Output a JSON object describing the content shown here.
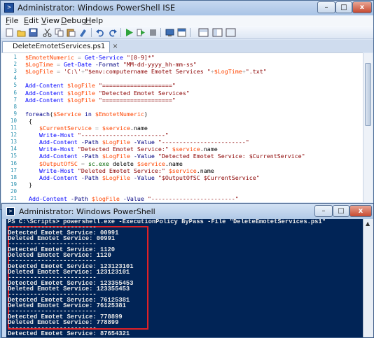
{
  "ise": {
    "title": "Administrator: Windows PowerShell ISE",
    "menu": [
      {
        "pre": "",
        "ul": "F",
        "post": "ile"
      },
      {
        "pre": "",
        "ul": "E",
        "post": "dit"
      },
      {
        "pre": "",
        "ul": "V",
        "post": "iew"
      },
      {
        "pre": "",
        "ul": "D",
        "post": "ebug"
      },
      {
        "pre": "",
        "ul": "H",
        "post": "elp"
      }
    ],
    "tab_label": "DeleteEmotetServices.ps1",
    "toolbar_icons": [
      "new-icon",
      "open-icon",
      "save-icon",
      "cut-icon",
      "copy-icon",
      "paste-icon",
      "clear-icon",
      "undo-icon",
      "redo-icon",
      "run-icon",
      "run-selection-icon",
      "stop-icon",
      "new-remote-tab-icon",
      "show-script-pane-top-icon",
      "show-script-pane-right-icon",
      "show-script-pane-maximized-icon"
    ]
  },
  "editor": {
    "line_numbers": [
      "1",
      "2",
      "3",
      "4",
      "5",
      "6",
      "7",
      "8",
      "9",
      "10",
      "11",
      "12",
      "13",
      "14",
      "15",
      "16",
      "17",
      "18",
      "19",
      "20",
      "21"
    ],
    "lines": [
      [
        {
          "c": "var",
          "t": "$EmotetNumeric"
        },
        {
          "c": "op",
          "t": " = "
        },
        {
          "c": "cmd",
          "t": "Get-Service"
        },
        {
          "c": "str",
          "t": " \"[0-9]*\""
        }
      ],
      [
        {
          "c": "var",
          "t": "$LogTime"
        },
        {
          "c": "op",
          "t": " = "
        },
        {
          "c": "cmd",
          "t": "Get-Date"
        },
        {
          "c": "prm",
          "t": " -Format"
        },
        {
          "c": "str",
          "t": " \"MM-dd-yyyy_hh-mm-ss\""
        }
      ],
      [
        {
          "c": "var",
          "t": "$LogFile"
        },
        {
          "c": "op",
          "t": " = "
        },
        {
          "c": "str",
          "t": "'C:\\'"
        },
        {
          "c": "op",
          "t": "+"
        },
        {
          "c": "str",
          "t": "\"$env:computername Emotet Services \""
        },
        {
          "c": "op",
          "t": "+"
        },
        {
          "c": "var",
          "t": "$LogTime"
        },
        {
          "c": "op",
          "t": "+"
        },
        {
          "c": "str",
          "t": "\".txt\""
        }
      ],
      [],
      [
        {
          "c": "cmd",
          "t": "Add-Content"
        },
        {
          "c": "var",
          "t": " $logFile"
        },
        {
          "c": "str",
          "t": " \"====================\""
        }
      ],
      [
        {
          "c": "cmd",
          "t": "Add-Content"
        },
        {
          "c": "var",
          "t": " $logFile"
        },
        {
          "c": "str",
          "t": " \"Detected Emotet Services\""
        }
      ],
      [
        {
          "c": "cmd",
          "t": "Add-Content"
        },
        {
          "c": "var",
          "t": " $logFile"
        },
        {
          "c": "str",
          "t": " \"====================\""
        }
      ],
      [],
      [
        {
          "c": "kw",
          "t": "foreach"
        },
        {
          "c": "txt",
          "t": "("
        },
        {
          "c": "var",
          "t": "$Service"
        },
        {
          "c": "kw",
          "t": " in "
        },
        {
          "c": "var",
          "t": "$EmotetNumeric"
        },
        {
          "c": "txt",
          "t": ")"
        }
      ],
      [
        {
          "c": "txt",
          "t": " {"
        }
      ],
      [
        {
          "c": "var",
          "t": "    $CurrentService"
        },
        {
          "c": "op",
          "t": " = "
        },
        {
          "c": "var",
          "t": "$service"
        },
        {
          "c": "txt",
          "t": ".name"
        }
      ],
      [
        {
          "c": "cmd",
          "t": "    Write-Host"
        },
        {
          "c": "str",
          "t": " \"------------------------\""
        }
      ],
      [
        {
          "c": "cmd",
          "t": "    Add-Content"
        },
        {
          "c": "prm",
          "t": " -Path"
        },
        {
          "c": "var",
          "t": " $LogFile"
        },
        {
          "c": "prm",
          "t": " -Value"
        },
        {
          "c": "str",
          "t": " \"------------------------\""
        }
      ],
      [
        {
          "c": "cmd",
          "t": "    Write-Host"
        },
        {
          "c": "str",
          "t": " \"Detected Emotet Service:\""
        },
        {
          "c": "var",
          "t": " $service"
        },
        {
          "c": "txt",
          "t": ".name"
        }
      ],
      [
        {
          "c": "cmd",
          "t": "    Add-Content"
        },
        {
          "c": "prm",
          "t": " -Path"
        },
        {
          "c": "var",
          "t": " $LogFile"
        },
        {
          "c": "prm",
          "t": " -Value"
        },
        {
          "c": "str",
          "t": " \"Detected Emotet Service: $CurrentService\""
        }
      ],
      [
        {
          "c": "var",
          "t": "    $OutputOfSC"
        },
        {
          "c": "op",
          "t": " = "
        },
        {
          "c": "ext",
          "t": "sc.exe"
        },
        {
          "c": "txt",
          "t": " delete "
        },
        {
          "c": "var",
          "t": "$service"
        },
        {
          "c": "txt",
          "t": ".name"
        }
      ],
      [
        {
          "c": "cmd",
          "t": "    Write-Host"
        },
        {
          "c": "str",
          "t": " \"Deleted Emotet Service:\""
        },
        {
          "c": "var",
          "t": " $service"
        },
        {
          "c": "txt",
          "t": ".name"
        }
      ],
      [
        {
          "c": "cmd",
          "t": "    Add-Content"
        },
        {
          "c": "prm",
          "t": " -Path"
        },
        {
          "c": "var",
          "t": " $LogFile"
        },
        {
          "c": "prm",
          "t": " -Value"
        },
        {
          "c": "str",
          "t": " \"$OutputOfSC $CurrentService\""
        }
      ],
      [
        {
          "c": "txt",
          "t": " }"
        }
      ],
      [],
      [
        {
          "c": "cmd",
          "t": " Add-Content"
        },
        {
          "c": "prm",
          "t": " -Path"
        },
        {
          "c": "var",
          "t": " $logFile"
        },
        {
          "c": "prm",
          "t": " -Value"
        },
        {
          "c": "str",
          "t": " \"------------------------\""
        }
      ]
    ]
  },
  "console": {
    "title": "Administrator: Windows PowerShell",
    "lines": [
      "PS C:\\Scripts> powershell.exe -ExecutionPolicy ByPass -File \"DeleteEmotetServices.ps1\"",
      "------------------------",
      "Detected Emotet Service: 00991",
      "Deleted Emotet Service: 00991",
      "------------------------",
      "Detected Emotet Service: 1120",
      "Deleted Emotet Service: 1120",
      "------------------------",
      "Detected Emotet Service: 123123101",
      "Deleted Emotet Service: 123123101",
      "------------------------",
      "Detected Emotet Service: 123355453",
      "Deleted Emotet Service: 123355453",
      "------------------------",
      "Detected Emotet Service: 76125381",
      "Deleted Emotet Service: 76125381",
      "------------------------",
      "Detected Emotet Service: 778899",
      "Deleted Emotet Service: 778899",
      "------------------------",
      "Detected Emotet Service: 87654321"
    ]
  },
  "window_controls": {
    "minimize": "–",
    "maximize": "□",
    "close": "x"
  },
  "colors": {
    "console_bg": "#012456",
    "highlight_box": "#e12126"
  }
}
